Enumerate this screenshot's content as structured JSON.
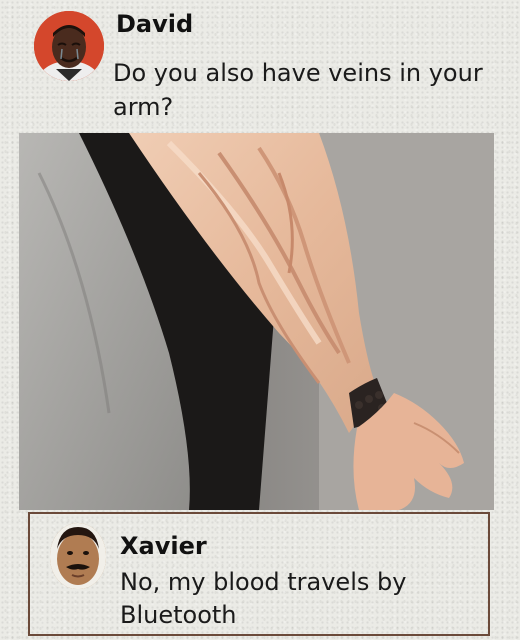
{
  "post": {
    "author": "David",
    "message": "Do you also have veins in your arm?",
    "image_subject": "veiny forearm with bracelet"
  },
  "reply": {
    "author": "Xavier",
    "message": "No, my blood travels by Bluetooth"
  },
  "colors": {
    "background": "#ebebe6",
    "reply_border": "#6b4a3a",
    "text": "#1a1a1a"
  }
}
